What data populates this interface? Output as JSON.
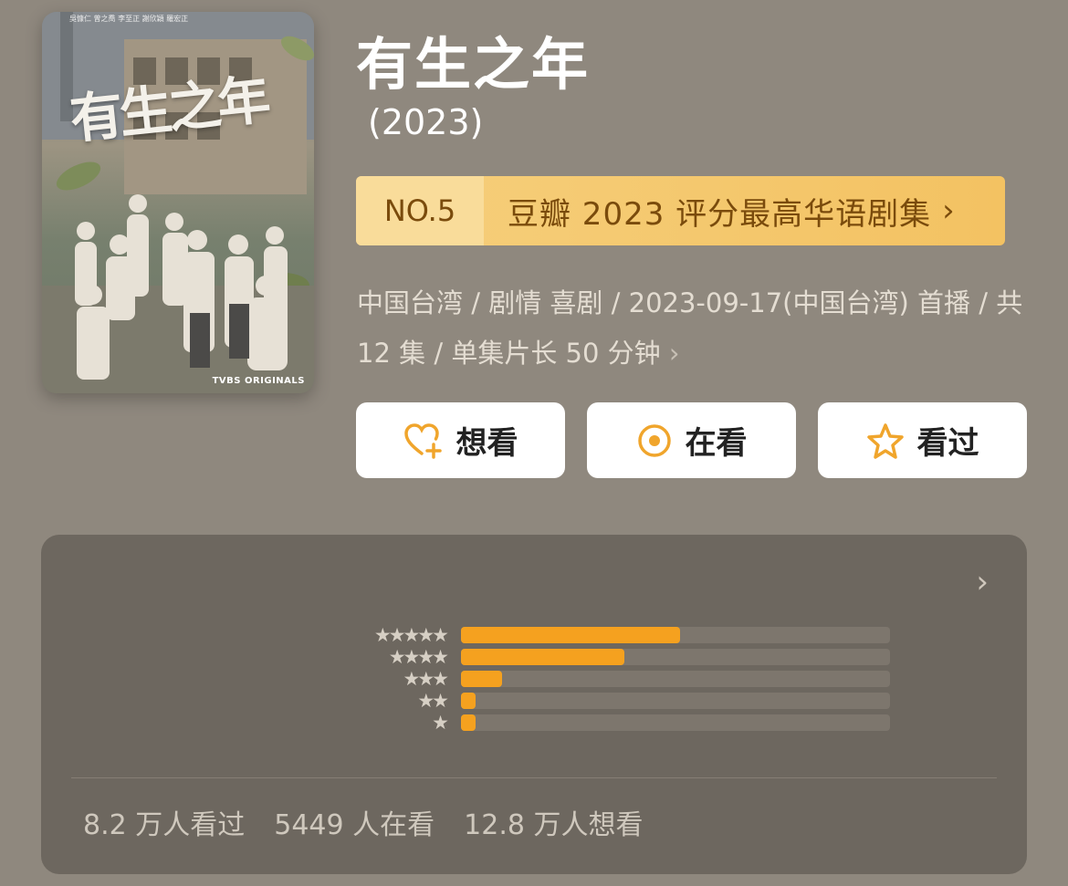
{
  "poster": {
    "title_art": "有生之年",
    "credits": "吳慷仁 曾之喬 李至正 謝欣穎 羅宏正",
    "brand": "TVBS ORIGINALS"
  },
  "title": "有生之年",
  "year": "(2023)",
  "ranking": {
    "number": "NO.5",
    "label": "豆瓣 2023 评分最高华语剧集",
    "chevron": "›"
  },
  "meta": {
    "text": "中国台湾 / 剧情 喜剧 / 2023-09-17(中国台湾) 首播 / 共 12 集 / 单集片长 50 分钟",
    "chevron": "›"
  },
  "actions": {
    "want": {
      "label": "想看",
      "icon": "heart-plus-icon"
    },
    "watching": {
      "label": "在看",
      "icon": "target-icon"
    },
    "watched": {
      "label": "看过",
      "icon": "star-icon"
    }
  },
  "rating": {
    "chevron": "›",
    "rows": [
      {
        "stars": "★★★★★",
        "fraction": 0.51
      },
      {
        "stars": "★★★★",
        "fraction": 0.38
      },
      {
        "stars": "★★★",
        "fraction": 0.095
      },
      {
        "stars": "★★",
        "fraction": 0.035
      },
      {
        "stars": "★",
        "fraction": 0.035
      }
    ]
  },
  "stats": {
    "watched": "8.2 万人看过",
    "watching": "5449 人在看",
    "want": "12.8 万人想看"
  },
  "colors": {
    "background": "#8f887e",
    "accent": "#f5a11f",
    "rank_text": "#7a4b0c",
    "card": "#6d675f"
  }
}
